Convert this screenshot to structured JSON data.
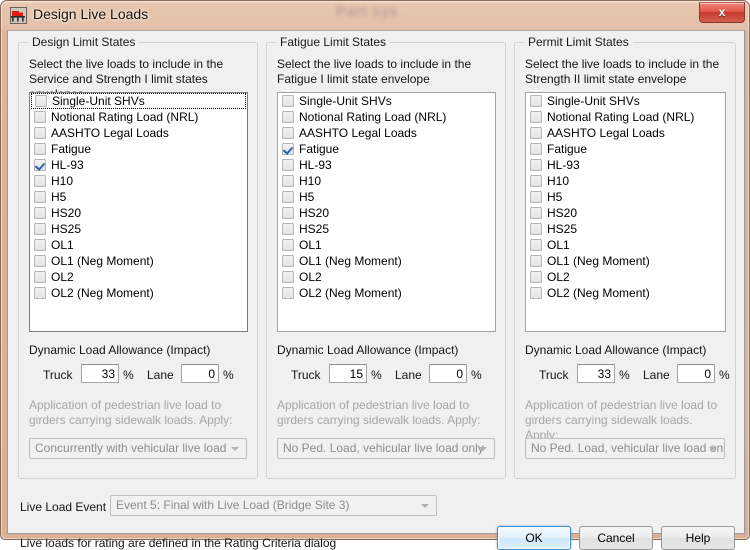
{
  "window": {
    "title": "Design Live Loads",
    "icon": "truck-bridge-icon",
    "close_label": "x",
    "watermark": "Part sys"
  },
  "panels": [
    {
      "id": "design",
      "title": "Design Limit States",
      "description": "Select the live loads to include in the Service and Strength I limit states envelopes",
      "items": [
        {
          "label": "Single-Unit SHVs",
          "checked": false,
          "focused": true
        },
        {
          "label": "Notional Rating Load (NRL)",
          "checked": false,
          "focused": false
        },
        {
          "label": "AASHTO Legal Loads",
          "checked": false,
          "focused": false
        },
        {
          "label": "Fatigue",
          "checked": false,
          "focused": false
        },
        {
          "label": "HL-93",
          "checked": true,
          "focused": false
        },
        {
          "label": "H10",
          "checked": false,
          "focused": false
        },
        {
          "label": "H5",
          "checked": false,
          "focused": false
        },
        {
          "label": "HS20",
          "checked": false,
          "focused": false
        },
        {
          "label": "HS25",
          "checked": false,
          "focused": false
        },
        {
          "label": "OL1",
          "checked": false,
          "focused": false
        },
        {
          "label": "OL1 (Neg Moment)",
          "checked": false,
          "focused": false
        },
        {
          "label": "OL2",
          "checked": false,
          "focused": false
        },
        {
          "label": "OL2 (Neg Moment)",
          "checked": false,
          "focused": false
        }
      ],
      "dla": {
        "title": "Dynamic Load Allowance (Impact)",
        "truck_label": "Truck",
        "truck_value": "33",
        "truck_unit": "%",
        "lane_label": "Lane",
        "lane_value": "0",
        "lane_unit": "%"
      },
      "pedestrian": {
        "text": "Application of pedestrian live load to girders carrying sidewalk loads. Apply:",
        "selected": "Concurrently with vehicular live load"
      }
    },
    {
      "id": "fatigue",
      "title": "Fatigue Limit States",
      "description": "Select the live loads to include in the Fatigue I limit state envelope",
      "items": [
        {
          "label": "Single-Unit SHVs",
          "checked": false,
          "focused": false
        },
        {
          "label": "Notional Rating Load (NRL)",
          "checked": false,
          "focused": false
        },
        {
          "label": "AASHTO Legal Loads",
          "checked": false,
          "focused": false
        },
        {
          "label": "Fatigue",
          "checked": true,
          "focused": false
        },
        {
          "label": "HL-93",
          "checked": false,
          "focused": false
        },
        {
          "label": "H10",
          "checked": false,
          "focused": false
        },
        {
          "label": "H5",
          "checked": false,
          "focused": false
        },
        {
          "label": "HS20",
          "checked": false,
          "focused": false
        },
        {
          "label": "HS25",
          "checked": false,
          "focused": false
        },
        {
          "label": "OL1",
          "checked": false,
          "focused": false
        },
        {
          "label": "OL1 (Neg Moment)",
          "checked": false,
          "focused": false
        },
        {
          "label": "OL2",
          "checked": false,
          "focused": false
        },
        {
          "label": "OL2 (Neg Moment)",
          "checked": false,
          "focused": false
        }
      ],
      "dla": {
        "title": "Dynamic Load Allowance (Impact)",
        "truck_label": "Truck",
        "truck_value": "15",
        "truck_unit": "%",
        "lane_label": "Lane",
        "lane_value": "0",
        "lane_unit": "%"
      },
      "pedestrian": {
        "text": "Application of pedestrian live load to girders carrying sidewalk loads. Apply:",
        "selected": "No Ped. Load, vehicular live load only"
      }
    },
    {
      "id": "permit",
      "title": "Permit Limit States",
      "description": "Select the live loads to include in the Strength II limit state envelope",
      "items": [
        {
          "label": "Single-Unit SHVs",
          "checked": false,
          "focused": false
        },
        {
          "label": "Notional Rating Load (NRL)",
          "checked": false,
          "focused": false
        },
        {
          "label": "AASHTO Legal Loads",
          "checked": false,
          "focused": false
        },
        {
          "label": "Fatigue",
          "checked": false,
          "focused": false
        },
        {
          "label": "HL-93",
          "checked": false,
          "focused": false
        },
        {
          "label": "H10",
          "checked": false,
          "focused": false
        },
        {
          "label": "H5",
          "checked": false,
          "focused": false
        },
        {
          "label": "HS20",
          "checked": false,
          "focused": false
        },
        {
          "label": "HS25",
          "checked": false,
          "focused": false
        },
        {
          "label": "OL1",
          "checked": false,
          "focused": false
        },
        {
          "label": "OL1 (Neg Moment)",
          "checked": false,
          "focused": false
        },
        {
          "label": "OL2",
          "checked": false,
          "focused": false
        },
        {
          "label": "OL2 (Neg Moment)",
          "checked": false,
          "focused": false
        }
      ],
      "dla": {
        "title": "Dynamic Load Allowance (Impact)",
        "truck_label": "Truck",
        "truck_value": "33",
        "truck_unit": "%",
        "lane_label": "Lane",
        "lane_value": "0",
        "lane_unit": "%"
      },
      "pedestrian": {
        "text": "Application of pedestrian live load to girders carrying sidewalk loads. Apply:",
        "selected": "No Ped. Load, vehicular live load only"
      }
    }
  ],
  "bottom": {
    "live_load_event_label": "Live Load Event",
    "live_load_event_value": "Event 5: Final with Live Load (Bridge Site 3)",
    "footnote": "Live loads for rating are defined in the Rating Criteria dialog",
    "ok_label": "OK",
    "cancel_label": "Cancel",
    "help_label": "Help"
  },
  "colors": {
    "accent": "#2a63b8",
    "frame": "#d9b096",
    "client_bg": "#f0f0f0",
    "close_red": "#c73b2e"
  }
}
